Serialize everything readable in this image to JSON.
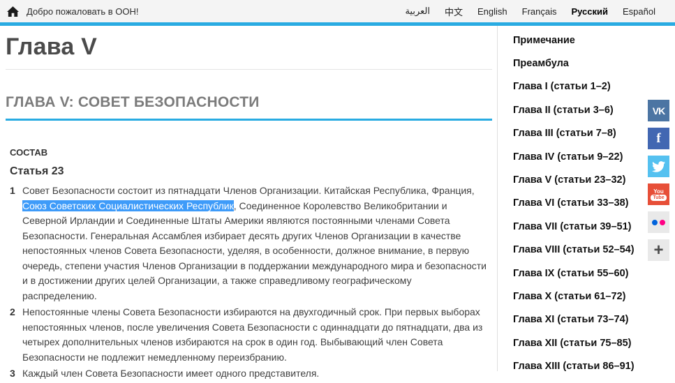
{
  "topbar": {
    "welcome": "Добро пожаловать в ООН!",
    "languages": [
      {
        "label": "العربية",
        "active": false
      },
      {
        "label": "中文",
        "active": false
      },
      {
        "label": "English",
        "active": false
      },
      {
        "label": "Français",
        "active": false
      },
      {
        "label": "Русский",
        "active": true
      },
      {
        "label": "Español",
        "active": false
      }
    ]
  },
  "page": {
    "title": "Глава V",
    "section_heading": "ГЛАВА V: СОВЕТ БЕЗОПАСНОСТИ",
    "subsection": "СОСТАВ",
    "article_title": "Статья 23",
    "paragraphs": [
      {
        "num": "1",
        "parts": [
          {
            "text": "Совет Безопасности состоит из пятнадцати Членов Организации. Китайская Республика, Франция, ",
            "highlight": false
          },
          {
            "text": "Союз Советских Социалистических Республик",
            "highlight": true
          },
          {
            "text": ", Соединенное Королевство Великобритании и Северной Ирландии и Соединенные Штаты Америки являются постоянными членами Совета Безопасности. Генеральная Ассамблея избирает десять других Членов Организации в качестве непостоянных членов Совета Безопасности, уделяя, в особенности, должное внимание, в первую очередь, степени участия Членов Организации в поддержании международного мира и безопасности и в достижении других целей Организации, а также справедливому географическому распределению.",
            "highlight": false
          }
        ]
      },
      {
        "num": "2",
        "parts": [
          {
            "text": "Непостоянные члены Совета Безопасности избираются на двухгодичный срок. При первых выборах непостоянных членов, после увеличения Совета Безопасности с одиннадцати до пятнадцати, два из четырех дополнительных членов избираются на срок в один год. Выбывающий член Совета Безопасности не подлежит немедленному переизбранию.",
            "highlight": false
          }
        ]
      },
      {
        "num": "3",
        "parts": [
          {
            "text": "Каждый член Совета Безопасности имеет одного представителя.",
            "highlight": false
          }
        ]
      }
    ]
  },
  "sidebar": {
    "items": [
      {
        "label": "Примечание"
      },
      {
        "label": "Преамбула"
      },
      {
        "label": "Глава I (статьи 1–2)"
      },
      {
        "label": "Глава II (статьи 3–6)"
      },
      {
        "label": "Глава III (статьи 7–8)"
      },
      {
        "label": "Глава IV (статьи 9–22)"
      },
      {
        "label": "Глава V (статьи 23–32)"
      },
      {
        "label": "Глава VI (статьи 33–38)"
      },
      {
        "label": "Глава VII (статьи 39–51)"
      },
      {
        "label": "Глава VIII (статьи 52–54)"
      },
      {
        "label": "Глава IX (статьи 55–60)"
      },
      {
        "label": "Глава X (статьи 61–72)"
      },
      {
        "label": "Глава XI (статьи 73–74)"
      },
      {
        "label": "Глава XII (статьи 75–85)"
      },
      {
        "label": "Глава XIII (статьи 86–91)"
      }
    ]
  },
  "social": [
    {
      "name": "vk-icon",
      "kind": "vk",
      "label": "VK",
      "bg": "#4c75a3"
    },
    {
      "name": "facebook-icon",
      "kind": "fb",
      "label": "f",
      "bg": "#4267b2"
    },
    {
      "name": "twitter-icon",
      "kind": "tw",
      "label": "",
      "bg": "#55c1f0"
    },
    {
      "name": "youtube-icon",
      "kind": "yt",
      "label_top": "You",
      "label_bottom": "Tube",
      "bg": "#e74f38"
    },
    {
      "name": "flickr-icon",
      "kind": "flickr",
      "bg": "#e9e9e9",
      "dot1": "#0063dc",
      "dot2": "#ff0084"
    },
    {
      "name": "share-plus-icon",
      "kind": "plus",
      "label": "+",
      "bg": "#e9e9e9"
    }
  ],
  "colors": {
    "accent": "#29abe2",
    "selection_bg": "#3e9bf9",
    "topbar_bg": "#f4f4f4"
  }
}
